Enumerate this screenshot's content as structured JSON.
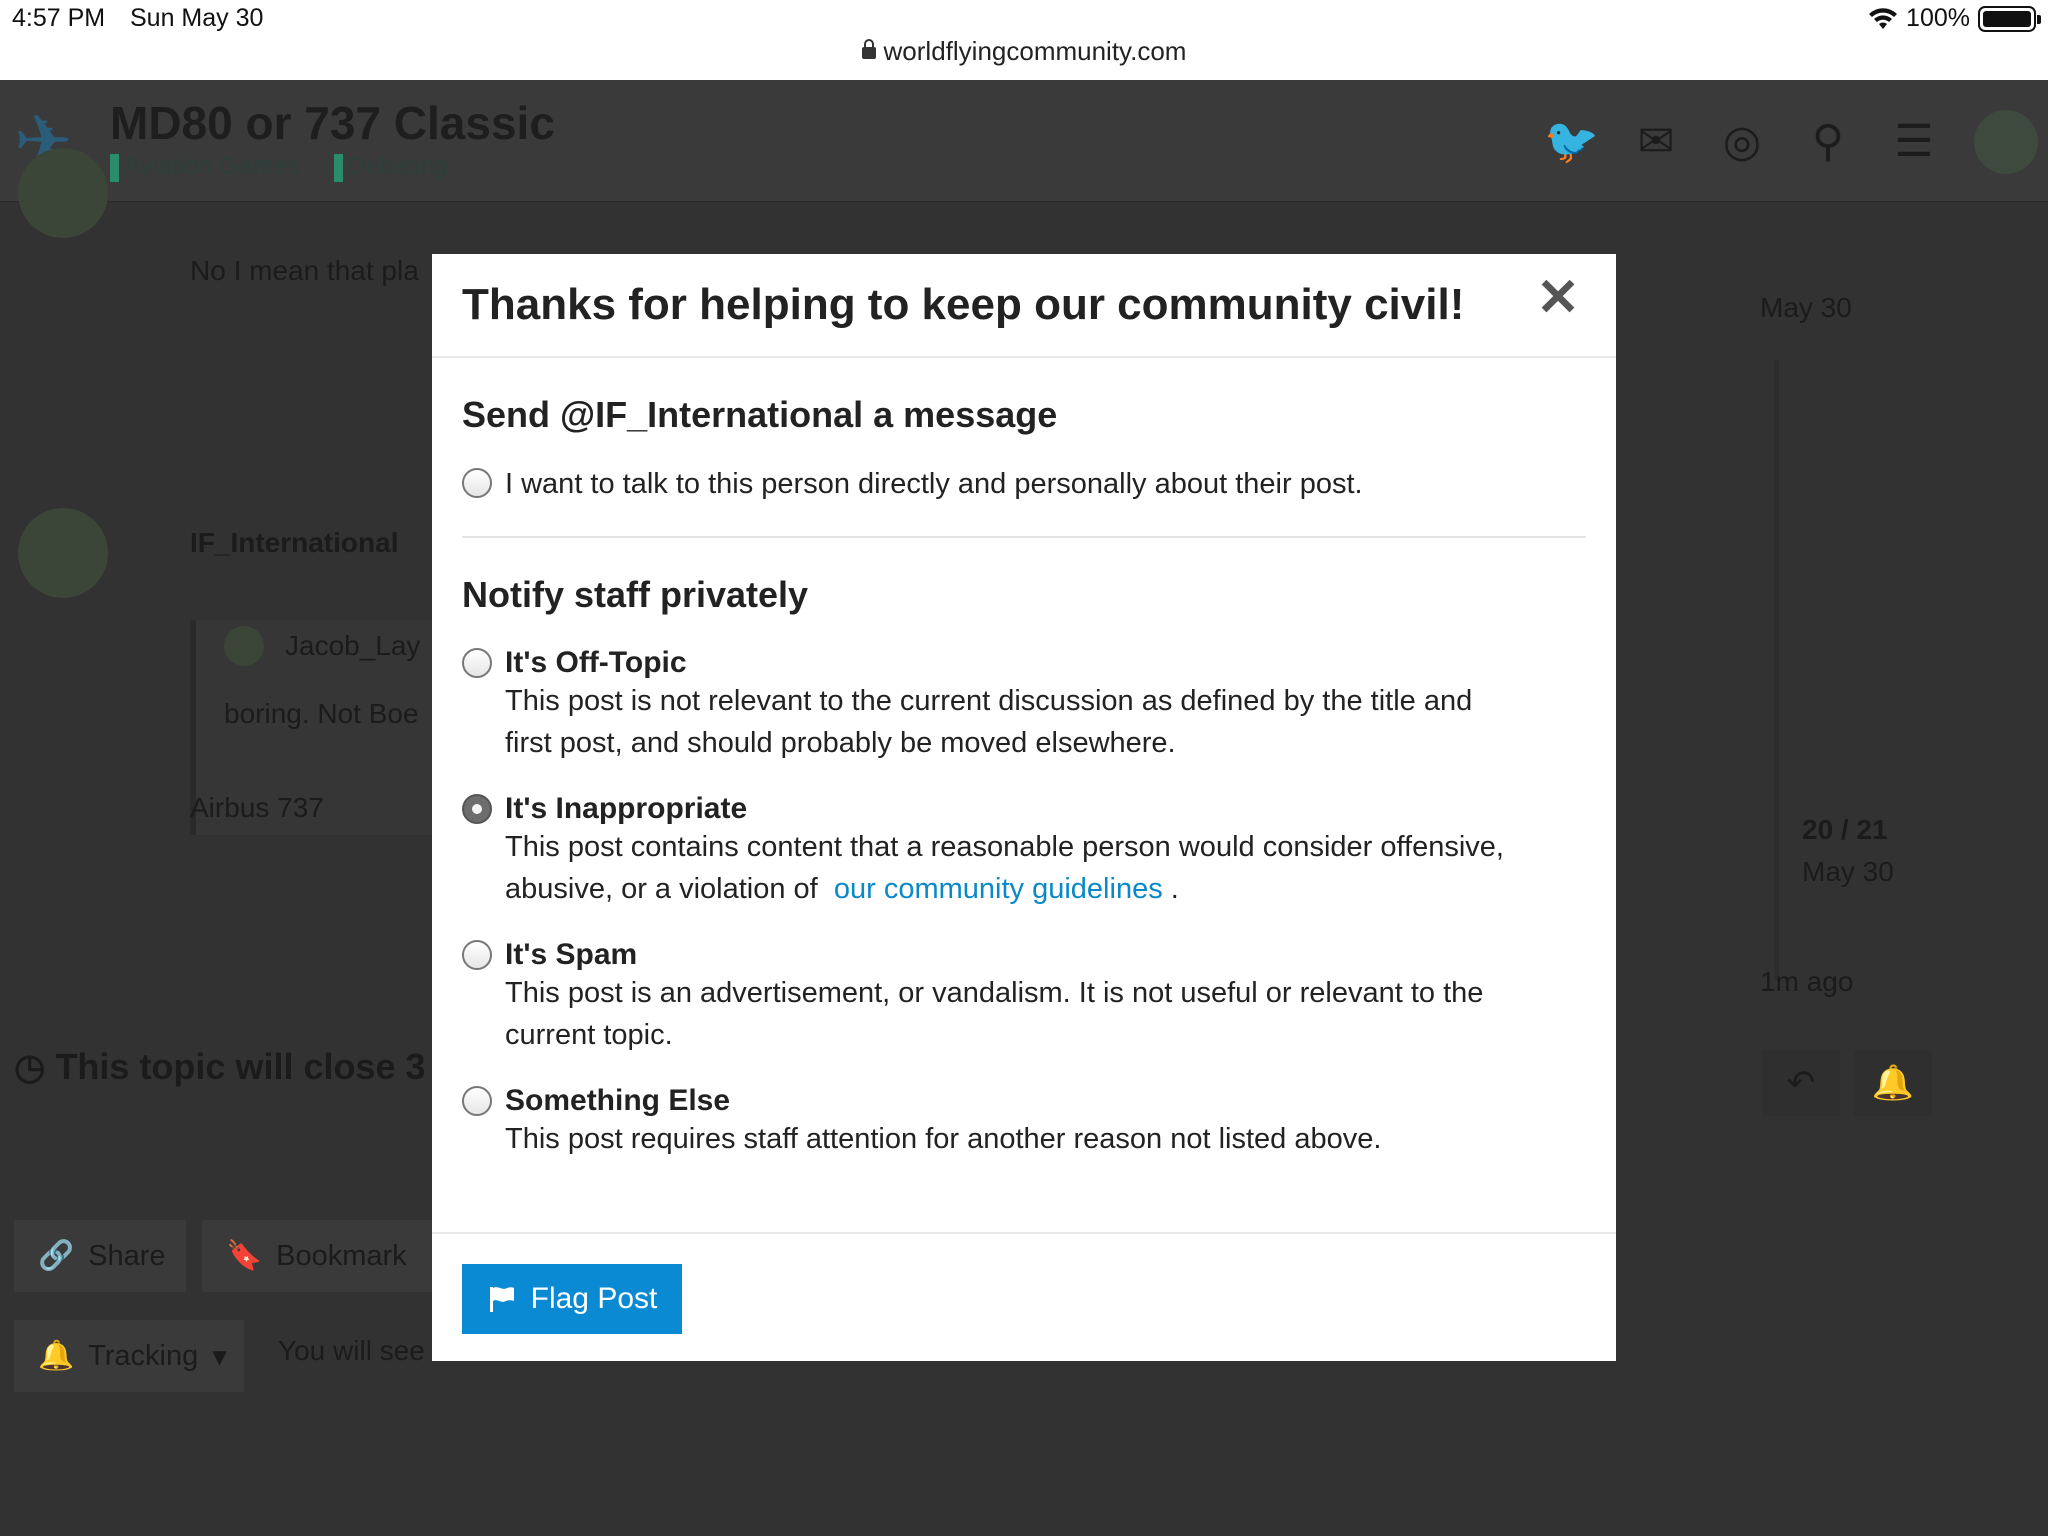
{
  "status": {
    "time": "4:57 PM",
    "date": "Sun May 30",
    "battery": "100%",
    "url": "worldflyingcommunity.com"
  },
  "site": {
    "title": "MD80 or 737 Classic",
    "categories": [
      "Aviation Games",
      "Debating"
    ],
    "post1_text": "No I mean that pla",
    "post2_user": "IF_International",
    "quote_user": "Jacob_Lay",
    "quote_text": "boring. Not Boe",
    "post2_text": "Airbus 737",
    "timeline_date_top": "May 30",
    "timeline_progress": "20 / 21",
    "timeline_date": "May 30",
    "timeline_ago": "1m ago",
    "close_notice": "This topic will close 3",
    "share_label": "Share",
    "bookmark_label": "Bookmark",
    "tracking_label": "Tracking",
    "tracking_text": "You will see"
  },
  "modal": {
    "title": "Thanks for helping to keep our community civil!",
    "section1_title": "Send @IF_International a message",
    "message_option": "I want to talk to this person directly and personally about their post.",
    "section2_title": "Notify staff privately",
    "options": [
      {
        "label": "It's Off-Topic",
        "desc": "This post is not relevant to the current discussion as defined by the title and first post, and should probably be moved elsewhere.",
        "checked": false
      },
      {
        "label": "It's Inappropriate",
        "desc": "This post contains content that a reasonable person would consider offensive, abusive, or a violation of",
        "link": "our community guidelines",
        "desc_end": ".",
        "checked": true
      },
      {
        "label": "It's Spam",
        "desc": "This post is an advertisement, or vandalism. It is not useful or relevant to the current topic.",
        "checked": false
      },
      {
        "label": "Something Else",
        "desc": "This post requires staff attention for another reason not listed above.",
        "checked": false
      }
    ],
    "flag_button": "Flag Post"
  },
  "colors": {
    "primary": "#0a8ad2",
    "link": "#0a88c8",
    "overlay_bg": "#323232"
  }
}
